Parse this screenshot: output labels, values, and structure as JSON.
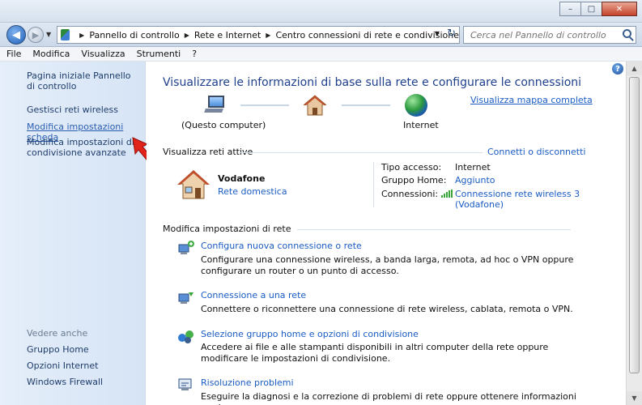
{
  "window": {
    "minimize": "–",
    "maximize": "□",
    "close": "✕"
  },
  "nav": {
    "back": "◀",
    "forward": "▶",
    "breadcrumbs": [
      "Pannello di controllo",
      "Rete e Internet",
      "Centro connessioni di rete e condivisione"
    ],
    "search_placeholder": "Cerca nel Pannello di controllo"
  },
  "menu": [
    "File",
    "Modifica",
    "Visualizza",
    "Strumenti",
    "?"
  ],
  "sidebar": {
    "items": [
      "Pagina iniziale Pannello di controllo",
      "Gestisci reti wireless",
      "Modifica impostazioni scheda",
      "Modifica impostazioni di condivisione avanzate"
    ],
    "see_also_heading": "Vedere anche",
    "see_also": [
      "Gruppo Home",
      "Opzioni Internet",
      "Windows Firewall"
    ]
  },
  "main": {
    "title": "Visualizzare le informazioni di base sulla rete e configurare le connessioni",
    "map_link": "Visualizza mappa completa",
    "map": {
      "computer_label": "(Questo computer)",
      "internet_label": "Internet"
    },
    "active_networks": {
      "heading": "Visualizza reti attive",
      "connect_link": "Connetti o disconnetti",
      "network_name": "Vodafone",
      "network_type": "Rete domestica",
      "access_type_label": "Tipo accesso:",
      "access_type_value": "Internet",
      "homegroup_label": "Gruppo Home:",
      "homegroup_value": "Aggiunto",
      "connections_label": "Connessioni:",
      "connection_value_1": "Connessione rete wireless 3",
      "connection_value_2": "(Vodafone)"
    },
    "settings_heading": "Modifica impostazioni di rete",
    "tasks": [
      {
        "title": "Configura nuova connessione o rete",
        "desc": "Configurare una connessione wireless, a banda larga, remota, ad hoc o VPN oppure configurare un router o un punto di accesso."
      },
      {
        "title": "Connessione a una rete",
        "desc": "Connettere o riconnettere una connessione di rete wireless, cablata, remota o VPN."
      },
      {
        "title": "Selezione gruppo home e opzioni di condivisione",
        "desc": "Accedere ai file e alle stampanti disponibili in altri computer della rete oppure modificare le impostazioni di condivisione."
      },
      {
        "title": "Risoluzione problemi",
        "desc": "Eseguire la diagnosi e la correzione di problemi di rete oppure ottenere informazioni per la"
      }
    ],
    "help": "?"
  },
  "colors": {
    "link": "#1a5cc4",
    "title": "#1e3f8c",
    "sidebar_bg": "#dce8f6",
    "arrow": "#e0231b"
  }
}
